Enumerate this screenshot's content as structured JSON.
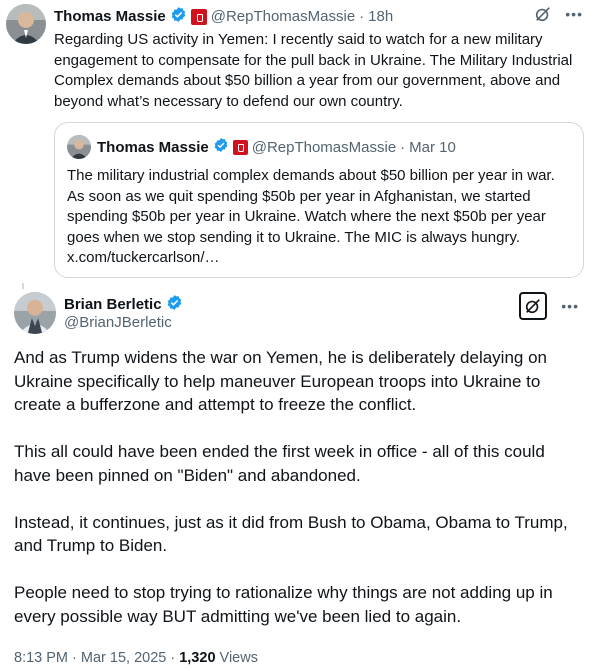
{
  "top_tweet": {
    "author_name": "Thomas Massie",
    "handle": "@RepThomasMassie",
    "separator": "·",
    "time": "18h",
    "text": "Regarding US activity in Yemen: I recently said to watch for a new military engagement to compensate for the pull back in Ukraine. The Military Industrial Complex demands about $50 billion a year from our government, above and beyond what’s necessary to defend our own country."
  },
  "quoted_tweet": {
    "author_name": "Thomas Massie",
    "handle": "@RepThomasMassie",
    "separator": "·",
    "time": "Mar 10",
    "text": "The military industrial complex demands about $50 billion per year in war. As soon as we quit spending $50b per year in Afghanistan, we started spending $50b per year in Ukraine. Watch where the next $50b per year goes when we stop sending it to Ukraine. The MIC is always hungry. x.com/tuckercarlson/…"
  },
  "main_tweet": {
    "author_name": "Brian Berletic",
    "handle": "@BrianJBerletic",
    "paragraphs": [
      "And as Trump widens the war on Yemen, he is deliberately delaying on Ukraine specifically to help maneuver European troops into Ukraine to create a bufferzone and attempt to freeze the conflict.",
      "This all could have been ended the first week in office - all of this could have been pinned on \"Biden\" and abandoned.",
      "Instead, it continues, just as it did from Bush to Obama, Obama to Trump, and Trump to Biden.",
      "People need to stop trying to  rationalize why things are not adding up in every possible way BUT admitting we've been lied to again."
    ],
    "timestamp": "8:13 PM · Mar 15, 2025 · ",
    "views_count": "1,320",
    "views_label": " Views"
  },
  "icons": {
    "verified": "verified-badge-icon",
    "flag": "government-flag-icon",
    "grok": "grok-icon",
    "more": "more-options-icon"
  },
  "colors": {
    "verified_blue": "#1d9bf0",
    "flag_red": "#d0121d",
    "muted_text": "#536471",
    "border": "#cfd9de"
  }
}
